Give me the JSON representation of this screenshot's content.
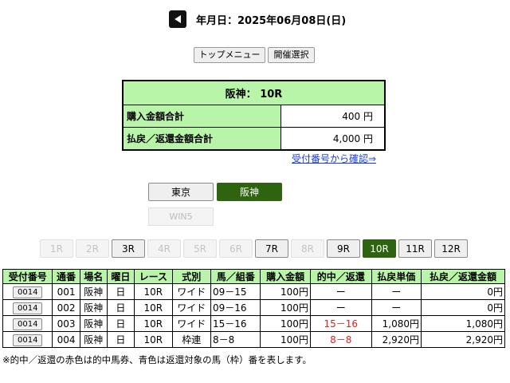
{
  "header": {
    "date_label": "年月日：2025年06月08日(日)"
  },
  "nav": {
    "top_menu": "トップメニュー",
    "kaisai": "開催選択"
  },
  "summary": {
    "title": "阪神： 10R",
    "purchase_label": "購入金額合計",
    "purchase_value": "400 円",
    "payout_label": "払戻／返還金額合計",
    "payout_value": "4,000 円",
    "confirm_link": "受付番号から確認⇒"
  },
  "venues": {
    "tokyo": "東京",
    "hanshin": "阪神",
    "win5": "WIN5",
    "selected": "hanshin"
  },
  "races": {
    "items": [
      "1R",
      "2R",
      "3R",
      "4R",
      "5R",
      "6R",
      "7R",
      "8R",
      "9R",
      "10R",
      "11R",
      "12R"
    ],
    "enabled": [
      "3R",
      "7R",
      "9R",
      "10R",
      "11R",
      "12R"
    ],
    "selected": "10R"
  },
  "results": {
    "headers": [
      "受付番号",
      "通番",
      "場名",
      "曜日",
      "レース",
      "式別",
      "馬／組番",
      "購入金額",
      "的中／返還",
      "払戻単価",
      "払戻／返還金額"
    ],
    "rows": [
      {
        "uketsuke": "0014",
        "tsuban": "001",
        "jo": "阪神",
        "youbi": "日",
        "race": "10R",
        "shikibetsu": "ワイド",
        "kumiban": "09－15",
        "kounyu": "100円",
        "tekichu": "ー",
        "tanka": "ー",
        "harai": "0円"
      },
      {
        "uketsuke": "0014",
        "tsuban": "002",
        "jo": "阪神",
        "youbi": "日",
        "race": "10R",
        "shikibetsu": "ワイド",
        "kumiban": "09－16",
        "kounyu": "100円",
        "tekichu": "ー",
        "tanka": "ー",
        "harai": "0円"
      },
      {
        "uketsuke": "0014",
        "tsuban": "003",
        "jo": "阪神",
        "youbi": "日",
        "race": "10R",
        "shikibetsu": "ワイド",
        "kumiban": "15－16",
        "kounyu": "100円",
        "tekichu": "15－16",
        "tanka": "1,080円",
        "harai": "1,080円"
      },
      {
        "uketsuke": "0014",
        "tsuban": "004",
        "jo": "阪神",
        "youbi": "日",
        "race": "10R",
        "shikibetsu": "枠連",
        "kumiban": "8－8",
        "kounyu": "100円",
        "tekichu": "8－8",
        "tanka": "2,920円",
        "harai": "2,920円"
      }
    ]
  },
  "note": "※的中／返還の赤色は的中馬券、青色は返還対象の馬（枠）番を表します。",
  "colors": {
    "header_green": "#b9f5a8",
    "selected_green": "#2e6410",
    "hit_red": "#e02020",
    "link_blue": "#1a3fd6"
  }
}
